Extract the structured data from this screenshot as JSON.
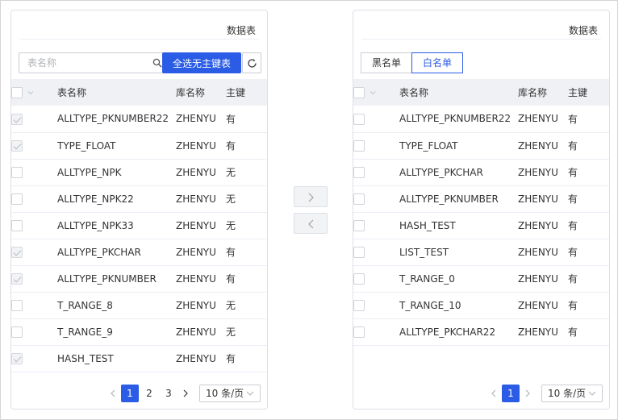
{
  "left": {
    "title": "数据表",
    "search_placeholder": "表名称",
    "select_all_label": "全选无主键表",
    "columns": {
      "name": "表名称",
      "db": "库名称",
      "pk": "主键"
    },
    "rows": [
      {
        "name": "ALLTYPE_PKNUMBER22",
        "db": "ZHENYU",
        "pk": "有",
        "checked": true
      },
      {
        "name": "TYPE_FLOAT",
        "db": "ZHENYU",
        "pk": "有",
        "checked": true
      },
      {
        "name": "ALLTYPE_NPK",
        "db": "ZHENYU",
        "pk": "无",
        "checked": false
      },
      {
        "name": "ALLTYPE_NPK22",
        "db": "ZHENYU",
        "pk": "无",
        "checked": false
      },
      {
        "name": "ALLTYPE_NPK33",
        "db": "ZHENYU",
        "pk": "无",
        "checked": false
      },
      {
        "name": "ALLTYPE_PKCHAR",
        "db": "ZHENYU",
        "pk": "有",
        "checked": true
      },
      {
        "name": "ALLTYPE_PKNUMBER",
        "db": "ZHENYU",
        "pk": "有",
        "checked": true
      },
      {
        "name": "T_RANGE_8",
        "db": "ZHENYU",
        "pk": "无",
        "checked": false
      },
      {
        "name": "T_RANGE_9",
        "db": "ZHENYU",
        "pk": "无",
        "checked": false
      },
      {
        "name": "HASH_TEST",
        "db": "ZHENYU",
        "pk": "有",
        "checked": true
      }
    ],
    "pagination": {
      "pages": [
        "1",
        "2",
        "3"
      ],
      "current": "1",
      "page_size": "10 条/页"
    }
  },
  "right": {
    "title": "数据表",
    "tabs": [
      {
        "label": "黑名单",
        "active": false
      },
      {
        "label": "白名单",
        "active": true
      }
    ],
    "columns": {
      "name": "表名称",
      "db": "库名称",
      "pk": "主键"
    },
    "rows": [
      {
        "name": "ALLTYPE_PKNUMBER22",
        "db": "ZHENYU",
        "pk": "有",
        "checked": false
      },
      {
        "name": "TYPE_FLOAT",
        "db": "ZHENYU",
        "pk": "有",
        "checked": false
      },
      {
        "name": "ALLTYPE_PKCHAR",
        "db": "ZHENYU",
        "pk": "有",
        "checked": false
      },
      {
        "name": "ALLTYPE_PKNUMBER",
        "db": "ZHENYU",
        "pk": "有",
        "checked": false
      },
      {
        "name": "HASH_TEST",
        "db": "ZHENYU",
        "pk": "有",
        "checked": false
      },
      {
        "name": "LIST_TEST",
        "db": "ZHENYU",
        "pk": "有",
        "checked": false
      },
      {
        "name": "T_RANGE_0",
        "db": "ZHENYU",
        "pk": "有",
        "checked": false
      },
      {
        "name": "T_RANGE_10",
        "db": "ZHENYU",
        "pk": "有",
        "checked": false
      },
      {
        "name": "ALLTYPE_PKCHAR22",
        "db": "ZHENYU",
        "pk": "有",
        "checked": false
      }
    ],
    "pagination": {
      "pages": [
        "1"
      ],
      "current": "1",
      "page_size": "10 条/页"
    }
  },
  "transfer": {
    "to_right_icon": "chevron-right-icon",
    "to_left_icon": "chevron-left-icon"
  },
  "colors": {
    "primary": "#2b5ce6",
    "header_bg": "#eff1f4",
    "border": "#dcdfe6"
  }
}
